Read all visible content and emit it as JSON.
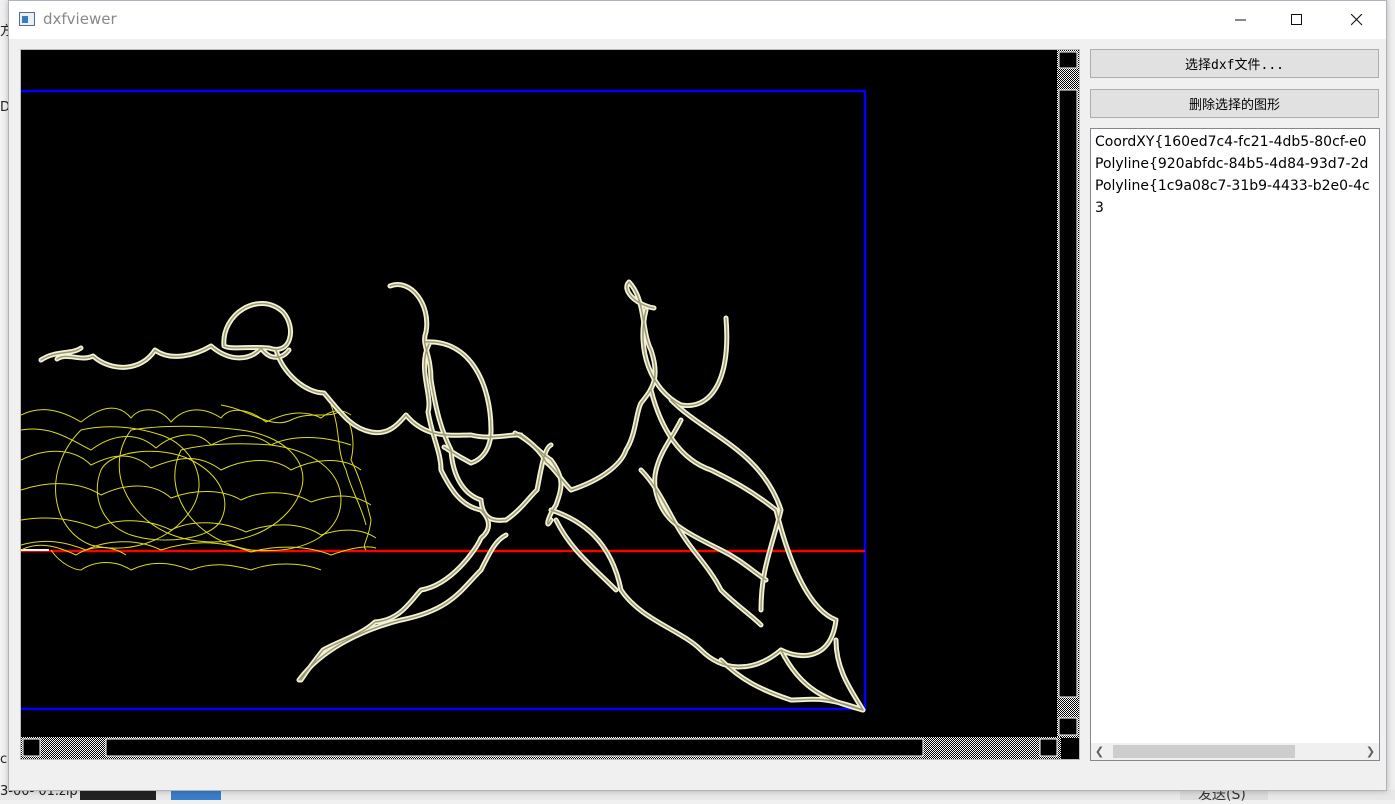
{
  "window": {
    "title": "dxfviewer",
    "icon": "app-window-icon"
  },
  "controls": {
    "minimize": "minimize-icon",
    "maximize": "maximize-icon",
    "close": "close-icon"
  },
  "panel": {
    "open_button": "选择dxf文件...",
    "delete_button": "删除选择的图形",
    "list_items": [
      "CoordXY{160ed7c4-fc21-4db5-80cf-e0",
      "Polyline{920abfdc-84b5-4d84-93d7-2d",
      "Polyline{1c9a08c7-31b9-4433-b2e0-4c",
      "3"
    ]
  },
  "background": {
    "frag_left_top": "方",
    "frag_left_mid": "Da",
    "frag_left_low": "c",
    "frag_bottom_file": "3-00- 01.zip",
    "frag_bottom_send": "发送(S)"
  },
  "colors": {
    "canvas": "#000000",
    "frame": "#0000ff",
    "axis": "#ff0000",
    "shape_halo": "#f5f3d6",
    "shape_stroke": "#9c9a74",
    "curve_yellow": "#dcdc1e"
  }
}
